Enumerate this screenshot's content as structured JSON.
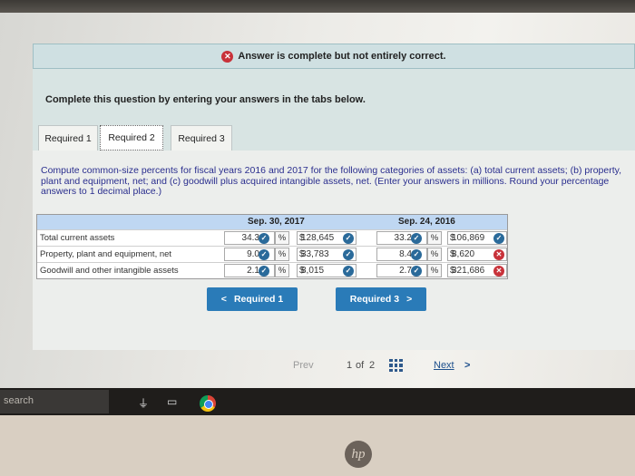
{
  "banner": {
    "text": "Answer is complete but not entirely correct.",
    "icon": "x-circle-icon"
  },
  "instructions": "Complete this question by entering your answers in the tabs below.",
  "tabs": [
    {
      "label": "Required 1",
      "active": false
    },
    {
      "label": "Required 2",
      "active": true
    },
    {
      "label": "Required 3",
      "active": false
    }
  ],
  "question": "Compute common-size percents for fiscal years 2016 and 2017 for the following categories of assets: (a) total current assets; (b) property, plant and equipment, net; and (c) goodwill plus acquired intangible assets, net. (Enter your answers in millions. Round your percentage answers to 1 decimal place.)",
  "table": {
    "columns": [
      "Sep. 30, 2017",
      "Sep. 24, 2016"
    ],
    "pct_symbol": "%",
    "currency": "$",
    "rows": [
      {
        "label": "Total current assets",
        "pct_2017": "34.3",
        "pct_2017_status": "correct",
        "amt_2017": "128,645",
        "amt_2017_status": "correct",
        "pct_2016": "33.2",
        "pct_2016_status": "correct",
        "amt_2016": "106,869",
        "amt_2016_status": "correct"
      },
      {
        "label": "Property, plant and equipment, net",
        "pct_2017": "9.0",
        "pct_2017_status": "correct",
        "amt_2017": "33,783",
        "amt_2017_status": "correct",
        "pct_2016": "8.4",
        "pct_2016_status": "correct",
        "amt_2016": "8,620",
        "amt_2016_status": "incorrect"
      },
      {
        "label": "Goodwill and other intangible assets",
        "pct_2017": "2.1",
        "pct_2017_status": "correct",
        "amt_2017": "8,015",
        "amt_2017_status": "correct",
        "pct_2016": "2.7",
        "pct_2016_status": "correct",
        "amt_2016": "321,686",
        "amt_2016_status": "incorrect"
      }
    ]
  },
  "nav": {
    "prev_label": "Required 1",
    "next_label": "Required 3"
  },
  "pager": {
    "prev": "Prev",
    "current": "1",
    "of": "of",
    "total": "2",
    "next": "Next"
  },
  "taskbar": {
    "search": "search"
  },
  "colors": {
    "accent": "#2a7bb8",
    "correct": "#2a6a9a",
    "incorrect": "#c8323a"
  },
  "brand": "hp"
}
